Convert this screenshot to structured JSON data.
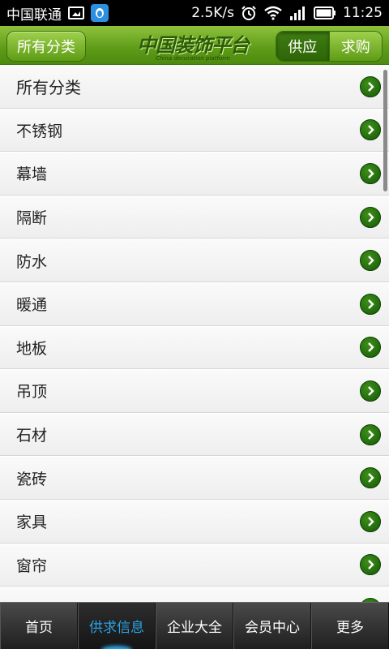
{
  "statusbar": {
    "carrier": "中国联通",
    "speed": "2.5K/s",
    "time": "11:25"
  },
  "header": {
    "category_button": "所有分类",
    "logo_text": "中国装饰平台",
    "logo_subtitle": "China decoration platform",
    "segment": {
      "supply": "供应",
      "demand": "求购",
      "active": "supply"
    }
  },
  "categories": [
    "所有分类",
    "不锈钢",
    "幕墙",
    "隔断",
    "防水",
    "暖通",
    "地板",
    "吊顶",
    "石材",
    "瓷砖",
    "家具",
    "窗帘",
    "..."
  ],
  "tabbar": {
    "tabs": [
      "首页",
      "供求信息",
      "企业大全",
      "会员中心",
      "更多"
    ],
    "active_index": 1
  },
  "colors": {
    "header_green": "#5d9b18",
    "arrow_green": "#135a05",
    "active_tab_text": "#2aa3e6"
  },
  "icons": {
    "row_chevron": "chevron-right-circle-icon",
    "notification": "qq-penguin-icon",
    "image": "image-icon",
    "alarm": "alarm-clock-icon",
    "wifi": "wifi-icon",
    "signal": "signal-bars-icon",
    "battery": "battery-icon"
  }
}
